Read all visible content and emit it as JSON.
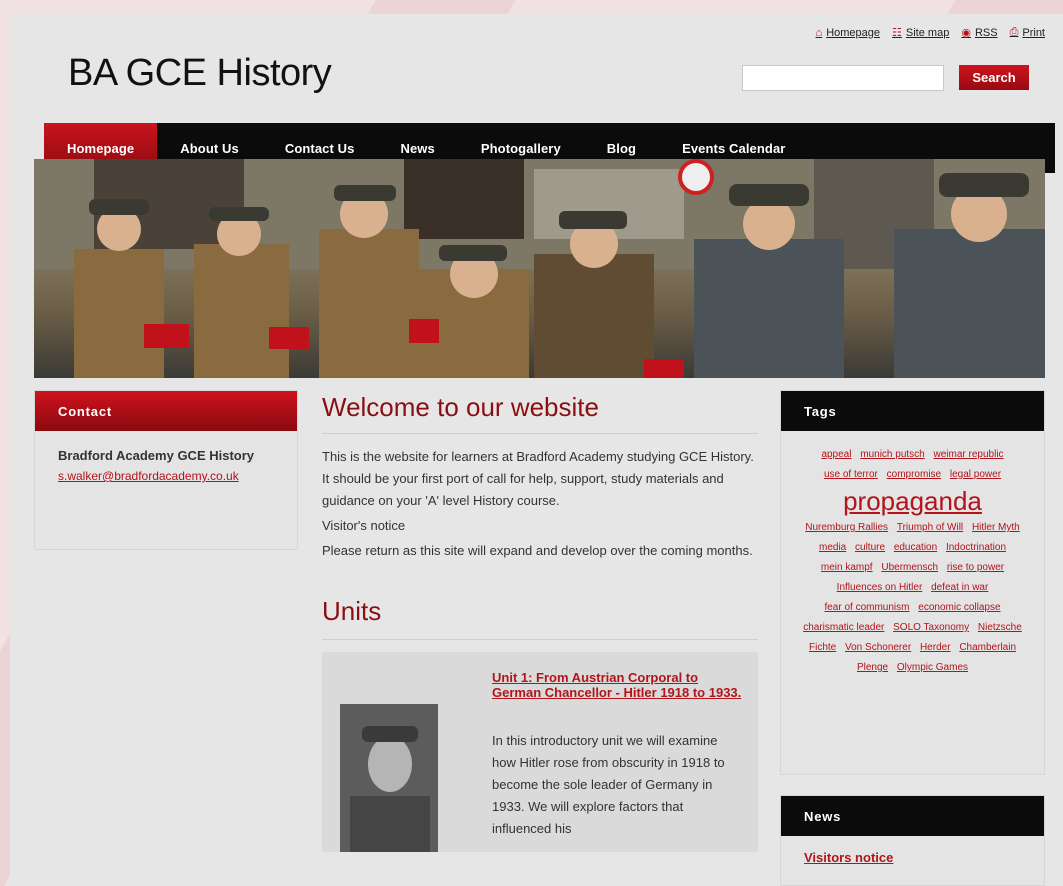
{
  "site": {
    "title": "BA GCE History"
  },
  "toplinks": [
    {
      "label": "Homepage",
      "icon": "home-icon",
      "glyph": "⌂"
    },
    {
      "label": "Site map",
      "icon": "sitemap-icon",
      "glyph": "☷"
    },
    {
      "label": "RSS",
      "icon": "rss-icon",
      "glyph": "◉"
    },
    {
      "label": "Print",
      "icon": "print-icon",
      "glyph": "⎙"
    }
  ],
  "search": {
    "placeholder": "",
    "button_label": "Search"
  },
  "nav": {
    "items": [
      "Homepage",
      "About Us",
      "Contact Us",
      "News",
      "Photogallery",
      "Blog",
      "Events Calendar"
    ],
    "active_index": 0
  },
  "contact": {
    "heading": "Contact",
    "name": "Bradford Academy GCE History",
    "email": "s.walker@bradfordacademy.co.uk"
  },
  "main": {
    "welcome_heading": "Welcome to our website",
    "intro": "This is the website for learners at Bradford Academy studying GCE History. It should be your first port of call for help, support, study materials and guidance on your 'A' level History course.",
    "notice_title": "Visitor's notice",
    "notice_text": "Please return as this site will expand and develop over the coming months.",
    "units_heading": "Units",
    "unit": {
      "title": "Unit 1: From Austrian Corporal to German Chancellor - Hitler 1918 to 1933.",
      "description": "In this introductory unit we will examine how Hitler rose from obscurity in 1918 to become the sole leader of Germany in 1933. We will explore factors that influenced his"
    }
  },
  "tags": {
    "heading": "Tags",
    "items": [
      "appeal",
      "munich putsch",
      "weimar republic",
      "use of terror",
      "compromise",
      "legal power",
      "propaganda",
      "Nuremburg Rallies",
      "Triumph of Will",
      "Hitler Myth",
      "media",
      "culture",
      "education",
      "Indoctrination",
      "mein kampf",
      "Ubermensch",
      "rise to power",
      "Influences on Hitler",
      "defeat in war",
      "fear of communism",
      "economic collapse",
      "charismatic leader",
      "SOLO Taxonomy",
      "Nietzsche",
      "Fichte",
      "Von Schonerer",
      "Herder",
      "Chamberlain",
      "Plenge",
      "Olympic Games"
    ],
    "big_tag": "propaganda"
  },
  "news": {
    "heading": "News",
    "items": [
      "Visitors notice"
    ]
  },
  "colors": {
    "accent": "#b3141b",
    "nav_bg": "#0b0b0b",
    "page_bg": "#e6e6e6"
  }
}
